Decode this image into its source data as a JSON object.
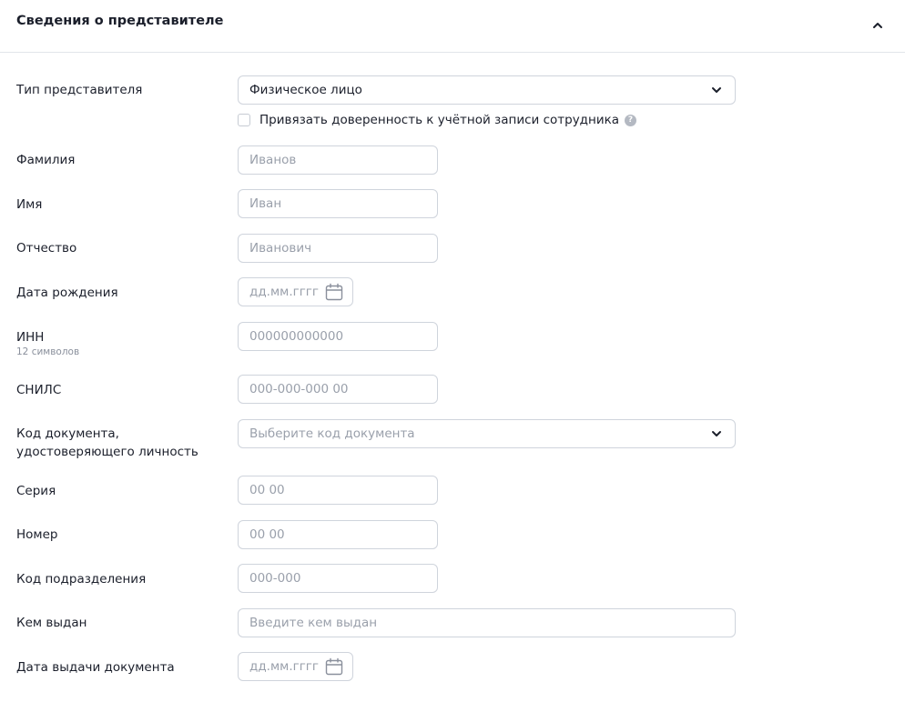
{
  "section": {
    "title": "Сведения о представителе"
  },
  "fields": {
    "rep_type": {
      "label": "Тип представителя",
      "value": "Физическое лицо"
    },
    "bind_checkbox": {
      "label": "Привязать доверенность к учётной записи сотрудника",
      "help": "?"
    },
    "last_name": {
      "label": "Фамилия",
      "placeholder": "Иванов"
    },
    "first_name": {
      "label": "Имя",
      "placeholder": "Иван"
    },
    "middle_name": {
      "label": "Отчество",
      "placeholder": "Иванович"
    },
    "birth_date": {
      "label": "Дата рождения",
      "placeholder": "дд.мм.гггг"
    },
    "inn": {
      "label": "ИНН",
      "hint": "12 символов",
      "placeholder": "000000000000"
    },
    "snils": {
      "label": "СНИЛС",
      "placeholder": "000-000-000 00"
    },
    "doc_code": {
      "label_line1": "Код документа,",
      "label_line2": "удостоверяющего личность",
      "placeholder": "Выберите код документа"
    },
    "series": {
      "label": "Серия",
      "placeholder": "00 00"
    },
    "number": {
      "label": "Номер",
      "placeholder": "00 00"
    },
    "division_code": {
      "label": "Код подразделения",
      "placeholder": "000-000"
    },
    "issued_by": {
      "label": "Кем выдан",
      "placeholder": "Введите кем выдан"
    },
    "issue_date": {
      "label": "Дата выдачи документа",
      "placeholder": "дд.мм.гггг"
    }
  },
  "icons": {
    "collapse": "chevron-up-icon",
    "dropdown": "chevron-down-icon",
    "calendar": "calendar-icon",
    "help": "question-icon"
  }
}
